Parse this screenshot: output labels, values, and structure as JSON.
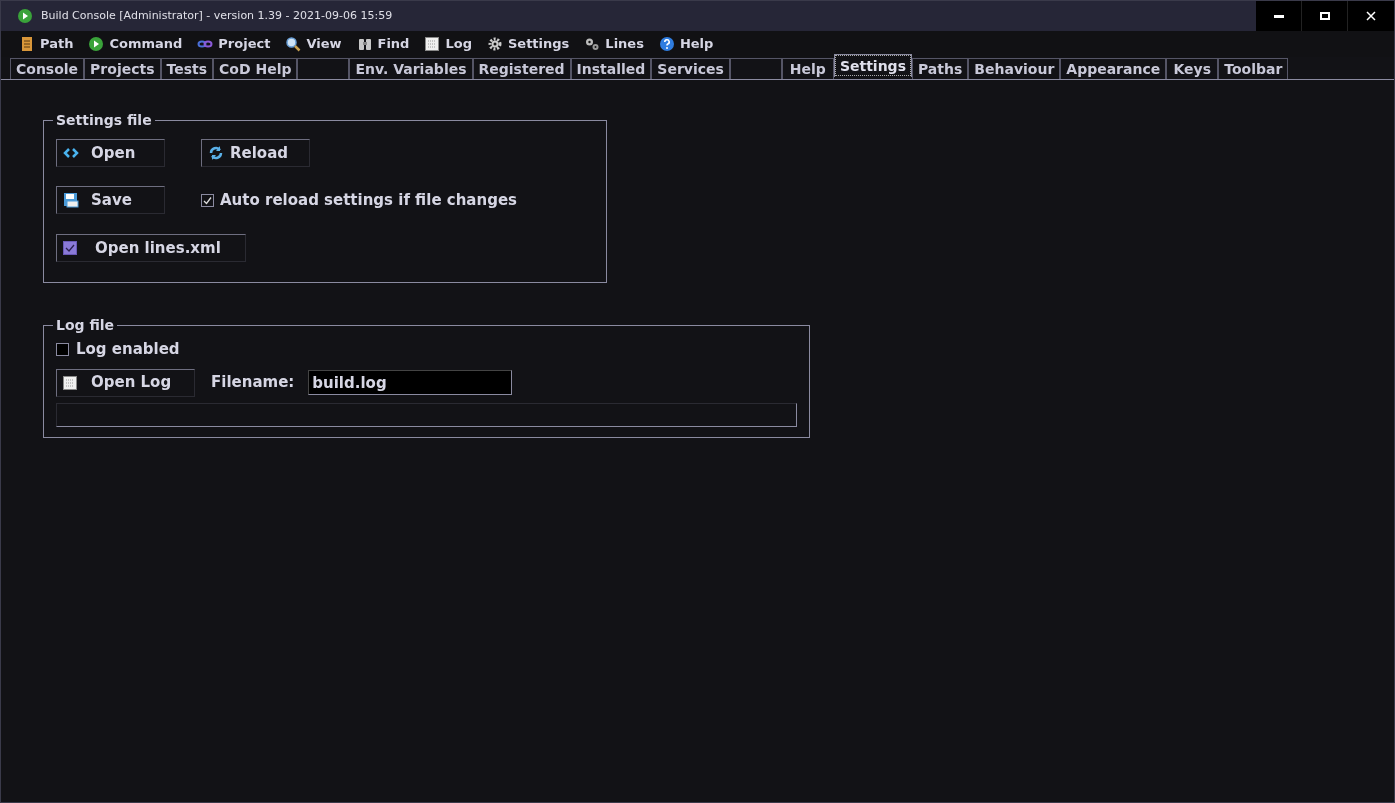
{
  "window": {
    "title": "Build Console [Administrator] - version 1.39 - 2021-09-06 15:59"
  },
  "menu": [
    {
      "label": "Path"
    },
    {
      "label": "Command"
    },
    {
      "label": "Project"
    },
    {
      "label": "View"
    },
    {
      "label": "Find"
    },
    {
      "label": "Log"
    },
    {
      "label": "Settings"
    },
    {
      "label": "Lines"
    },
    {
      "label": "Help"
    }
  ],
  "tabs": [
    {
      "label": "Console",
      "selected": false
    },
    {
      "label": "Projects",
      "selected": false
    },
    {
      "label": "Tests",
      "selected": false
    },
    {
      "label": "CoD Help",
      "selected": false
    },
    {
      "selected": false
    },
    {
      "label": "Env. Variables",
      "selected": false
    },
    {
      "label": "Registered",
      "selected": false
    },
    {
      "label": "Installed",
      "selected": false
    },
    {
      "label": "Services",
      "selected": false
    },
    {
      "selected": false
    },
    {
      "label": "Help",
      "selected": false
    },
    {
      "label": "Settings",
      "selected": true
    },
    {
      "label": "Paths",
      "selected": false
    },
    {
      "label": "Behaviour",
      "selected": false
    },
    {
      "label": "Appearance",
      "selected": false
    },
    {
      "label": "Keys",
      "selected": false
    },
    {
      "label": "Toolbar",
      "selected": false
    }
  ],
  "settings_file": {
    "title": "Settings file",
    "open_button": {
      "label": "Open"
    },
    "reload_button": {
      "label": "Reload"
    },
    "save_button": {
      "label": "Save"
    },
    "auto_reload": {
      "label": "Auto reload settings if file changes",
      "checked": true
    },
    "open_lines_button": {
      "label": "Open lines.xml"
    }
  },
  "log_file": {
    "title": "Log file",
    "log_enabled": {
      "label": "Log enabled",
      "checked": false
    },
    "open_log_button": {
      "label": "Open Log"
    },
    "filename_label": "Filename:",
    "filename": "build.log"
  }
}
